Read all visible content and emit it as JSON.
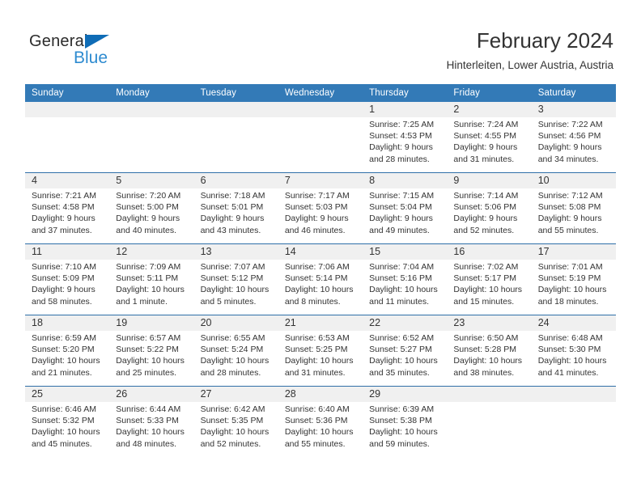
{
  "brand": {
    "name_part1": "General",
    "name_part2": "Blue",
    "triangle_color": "#0f6cb6",
    "blue_color": "#2e8bd0"
  },
  "header": {
    "title": "February 2024",
    "subtitle": "Hinterleiten, Lower Austria, Austria"
  },
  "theme": {
    "header_bg": "#337ab7",
    "daynum_bg": "#f0f0f0",
    "rule_color": "#2f6fa8",
    "text_color": "#333333"
  },
  "weekdays": [
    "Sunday",
    "Monday",
    "Tuesday",
    "Wednesday",
    "Thursday",
    "Friday",
    "Saturday"
  ],
  "weeks": [
    [
      {
        "day": "",
        "lines": []
      },
      {
        "day": "",
        "lines": []
      },
      {
        "day": "",
        "lines": []
      },
      {
        "day": "",
        "lines": []
      },
      {
        "day": "1",
        "lines": [
          "Sunrise: 7:25 AM",
          "Sunset: 4:53 PM",
          "Daylight: 9 hours",
          "and 28 minutes."
        ]
      },
      {
        "day": "2",
        "lines": [
          "Sunrise: 7:24 AM",
          "Sunset: 4:55 PM",
          "Daylight: 9 hours",
          "and 31 minutes."
        ]
      },
      {
        "day": "3",
        "lines": [
          "Sunrise: 7:22 AM",
          "Sunset: 4:56 PM",
          "Daylight: 9 hours",
          "and 34 minutes."
        ]
      }
    ],
    [
      {
        "day": "4",
        "lines": [
          "Sunrise: 7:21 AM",
          "Sunset: 4:58 PM",
          "Daylight: 9 hours",
          "and 37 minutes."
        ]
      },
      {
        "day": "5",
        "lines": [
          "Sunrise: 7:20 AM",
          "Sunset: 5:00 PM",
          "Daylight: 9 hours",
          "and 40 minutes."
        ]
      },
      {
        "day": "6",
        "lines": [
          "Sunrise: 7:18 AM",
          "Sunset: 5:01 PM",
          "Daylight: 9 hours",
          "and 43 minutes."
        ]
      },
      {
        "day": "7",
        "lines": [
          "Sunrise: 7:17 AM",
          "Sunset: 5:03 PM",
          "Daylight: 9 hours",
          "and 46 minutes."
        ]
      },
      {
        "day": "8",
        "lines": [
          "Sunrise: 7:15 AM",
          "Sunset: 5:04 PM",
          "Daylight: 9 hours",
          "and 49 minutes."
        ]
      },
      {
        "day": "9",
        "lines": [
          "Sunrise: 7:14 AM",
          "Sunset: 5:06 PM",
          "Daylight: 9 hours",
          "and 52 minutes."
        ]
      },
      {
        "day": "10",
        "lines": [
          "Sunrise: 7:12 AM",
          "Sunset: 5:08 PM",
          "Daylight: 9 hours",
          "and 55 minutes."
        ]
      }
    ],
    [
      {
        "day": "11",
        "lines": [
          "Sunrise: 7:10 AM",
          "Sunset: 5:09 PM",
          "Daylight: 9 hours",
          "and 58 minutes."
        ]
      },
      {
        "day": "12",
        "lines": [
          "Sunrise: 7:09 AM",
          "Sunset: 5:11 PM",
          "Daylight: 10 hours",
          "and 1 minute."
        ]
      },
      {
        "day": "13",
        "lines": [
          "Sunrise: 7:07 AM",
          "Sunset: 5:12 PM",
          "Daylight: 10 hours",
          "and 5 minutes."
        ]
      },
      {
        "day": "14",
        "lines": [
          "Sunrise: 7:06 AM",
          "Sunset: 5:14 PM",
          "Daylight: 10 hours",
          "and 8 minutes."
        ]
      },
      {
        "day": "15",
        "lines": [
          "Sunrise: 7:04 AM",
          "Sunset: 5:16 PM",
          "Daylight: 10 hours",
          "and 11 minutes."
        ]
      },
      {
        "day": "16",
        "lines": [
          "Sunrise: 7:02 AM",
          "Sunset: 5:17 PM",
          "Daylight: 10 hours",
          "and 15 minutes."
        ]
      },
      {
        "day": "17",
        "lines": [
          "Sunrise: 7:01 AM",
          "Sunset: 5:19 PM",
          "Daylight: 10 hours",
          "and 18 minutes."
        ]
      }
    ],
    [
      {
        "day": "18",
        "lines": [
          "Sunrise: 6:59 AM",
          "Sunset: 5:20 PM",
          "Daylight: 10 hours",
          "and 21 minutes."
        ]
      },
      {
        "day": "19",
        "lines": [
          "Sunrise: 6:57 AM",
          "Sunset: 5:22 PM",
          "Daylight: 10 hours",
          "and 25 minutes."
        ]
      },
      {
        "day": "20",
        "lines": [
          "Sunrise: 6:55 AM",
          "Sunset: 5:24 PM",
          "Daylight: 10 hours",
          "and 28 minutes."
        ]
      },
      {
        "day": "21",
        "lines": [
          "Sunrise: 6:53 AM",
          "Sunset: 5:25 PM",
          "Daylight: 10 hours",
          "and 31 minutes."
        ]
      },
      {
        "day": "22",
        "lines": [
          "Sunrise: 6:52 AM",
          "Sunset: 5:27 PM",
          "Daylight: 10 hours",
          "and 35 minutes."
        ]
      },
      {
        "day": "23",
        "lines": [
          "Sunrise: 6:50 AM",
          "Sunset: 5:28 PM",
          "Daylight: 10 hours",
          "and 38 minutes."
        ]
      },
      {
        "day": "24",
        "lines": [
          "Sunrise: 6:48 AM",
          "Sunset: 5:30 PM",
          "Daylight: 10 hours",
          "and 41 minutes."
        ]
      }
    ],
    [
      {
        "day": "25",
        "lines": [
          "Sunrise: 6:46 AM",
          "Sunset: 5:32 PM",
          "Daylight: 10 hours",
          "and 45 minutes."
        ]
      },
      {
        "day": "26",
        "lines": [
          "Sunrise: 6:44 AM",
          "Sunset: 5:33 PM",
          "Daylight: 10 hours",
          "and 48 minutes."
        ]
      },
      {
        "day": "27",
        "lines": [
          "Sunrise: 6:42 AM",
          "Sunset: 5:35 PM",
          "Daylight: 10 hours",
          "and 52 minutes."
        ]
      },
      {
        "day": "28",
        "lines": [
          "Sunrise: 6:40 AM",
          "Sunset: 5:36 PM",
          "Daylight: 10 hours",
          "and 55 minutes."
        ]
      },
      {
        "day": "29",
        "lines": [
          "Sunrise: 6:39 AM",
          "Sunset: 5:38 PM",
          "Daylight: 10 hours",
          "and 59 minutes."
        ]
      },
      {
        "day": "",
        "lines": []
      },
      {
        "day": "",
        "lines": []
      }
    ]
  ]
}
